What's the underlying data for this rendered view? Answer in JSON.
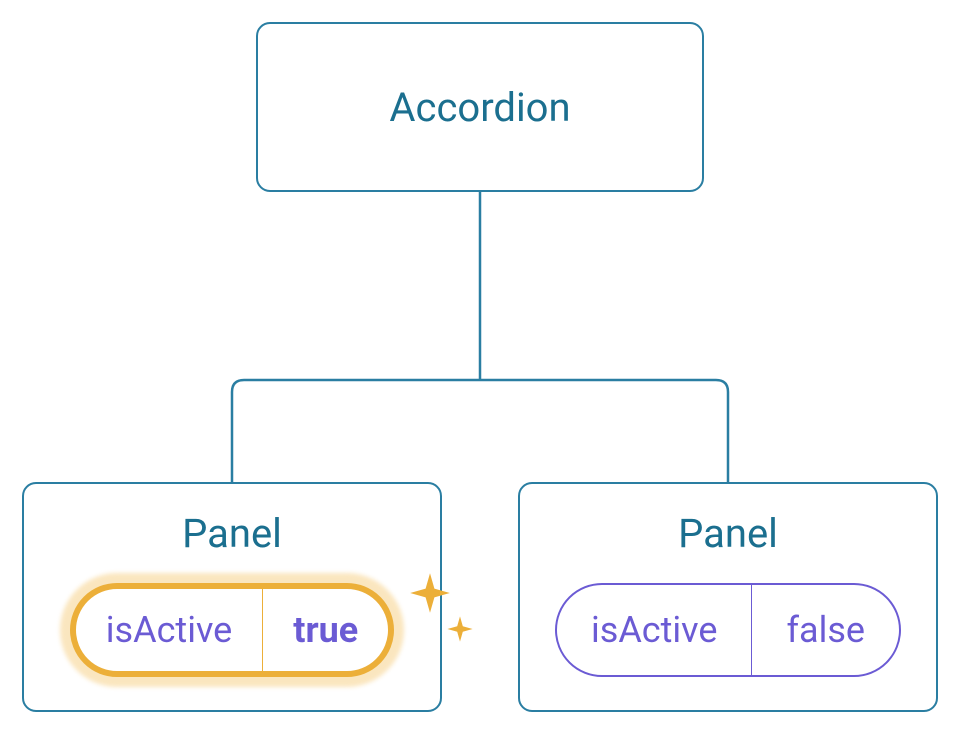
{
  "root": {
    "label": "Accordion"
  },
  "panels": [
    {
      "label": "Panel",
      "badge": {
        "key": "isActive",
        "value": "true"
      },
      "active": true
    },
    {
      "label": "Panel",
      "badge": {
        "key": "isActive",
        "value": "false"
      },
      "active": false
    }
  ],
  "colors": {
    "blue": "#1b6f8f",
    "purple": "#6b5bd4",
    "orange": "#ecaf39"
  }
}
